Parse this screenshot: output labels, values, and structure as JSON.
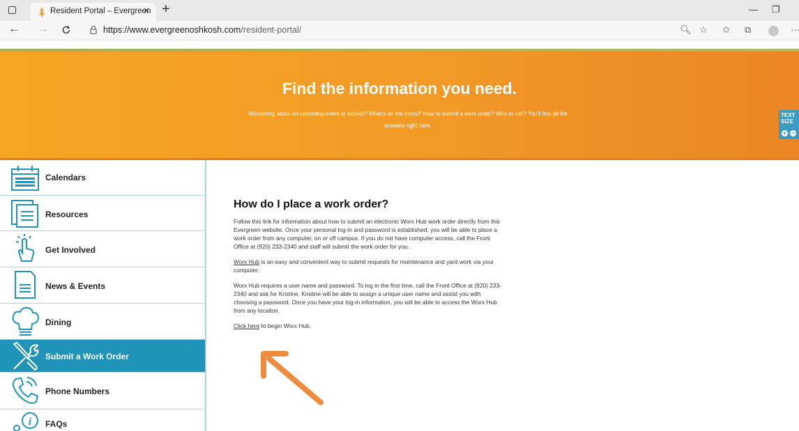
{
  "browser": {
    "tab_title": "Resident Portal – Evergreen",
    "tab_close": "×",
    "new_tab": "+",
    "url_host": "https://www.evergreenoshkosh.com",
    "url_path": "/resident-portal/",
    "window_minimize": "—",
    "window_restore": "❐",
    "more_menu": "···"
  },
  "hero": {
    "title": "Find the information you need.",
    "subtitle": "Wondering about an upcoming event or activity? What's on the menu? How to submit a work order? Who to call? You'll find all the answers right here."
  },
  "text_size": {
    "label": "TEXT SIZE",
    "plus": "+",
    "minus": "−"
  },
  "sidebar": {
    "items": [
      {
        "label": "Calendars",
        "icon": "calendar-icon"
      },
      {
        "label": "Resources",
        "icon": "documents-icon"
      },
      {
        "label": "Get Involved",
        "icon": "hand-pointer-icon"
      },
      {
        "label": "News & Events",
        "icon": "newspaper-icon"
      },
      {
        "label": "Dining",
        "icon": "chef-hat-icon"
      },
      {
        "label": "Submit a Work Order",
        "icon": "wrench-screwdriver-icon",
        "active": true
      },
      {
        "label": "Phone Numbers",
        "icon": "phone-icon"
      },
      {
        "label": "FAQs",
        "icon": "info-icon"
      }
    ]
  },
  "main": {
    "title": "How do I place a work order?",
    "p1": "Follow this link for information about how to submit an electronic Worx Hub work order directly from this Evergreen website. Once your personal log-in and password is established, you will be able to place a work order from any computer, on or off campus. If you do not have computer access, call the Front Office at (920) 233-2340 and staff will submit the work order for you.",
    "p2_link": "Worx Hub",
    "p2_rest": " is an easy and convenient way to submit requests for maintenance and yard work via your computer.",
    "p3": "Worx Hub requires a user name and password. To log in the first time, call the Front Office at (920) 233-2340 and ask for Kristine. Kristine will be able to assign a unique user name and assist you with choosing a password. Once you have your log-in information, you will be able to access the Worx Hub from any location.",
    "p4_link": "Click here",
    "p4_rest": " to begin Worx Hub."
  },
  "colors": {
    "hero_orange": "#f29b26",
    "sidebar_active": "#1f94b8",
    "sidebar_icon": "#1f94b8",
    "arrow": "#f08a3c"
  }
}
